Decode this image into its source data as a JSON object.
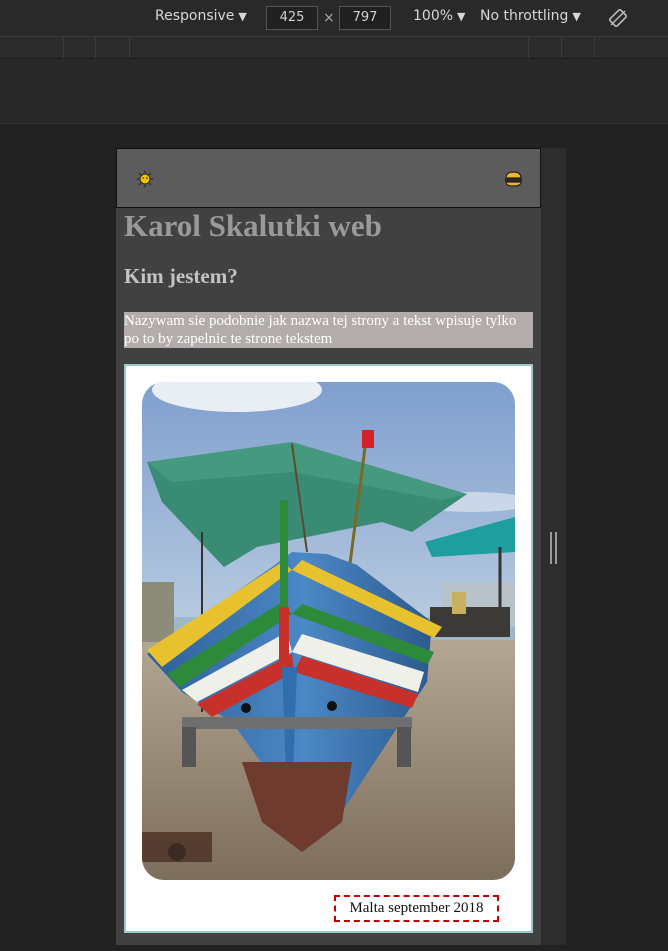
{
  "devtools": {
    "device_mode": "Responsive",
    "width": "425",
    "height": "797",
    "times": "×",
    "zoom": "100%",
    "throttling": "No throttling",
    "arrow": "▼",
    "rotate_icon": "rotate-icon"
  },
  "site": {
    "nav": {
      "left_icon": "sun-icon",
      "right_icon": "hamburger-icon"
    },
    "title": "Karol Skalutki web",
    "heading": "Kim jestem?",
    "intro": "Nazywam sie podobnie jak nazwa tej strony a tekst wpisuje tylko po to by zapelnic te strone tekstem",
    "photo_caption": "Malta september 2018",
    "colors": {
      "nav_bg": "#5c5c5c",
      "page_bg": "#414141",
      "intro_bg": "#b4abab",
      "card_border": "#9bc9c9",
      "caption_border": "#c00000"
    }
  }
}
